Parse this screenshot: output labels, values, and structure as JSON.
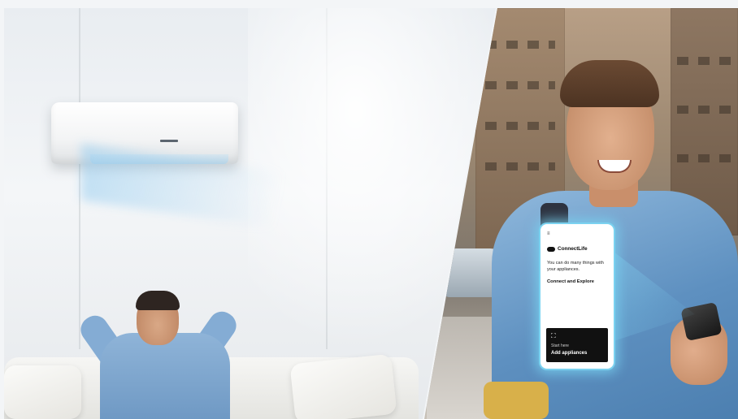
{
  "phone_ui": {
    "menu_glyph": "≡",
    "brand_logo_icon": "connectlife-logo-icon",
    "brand_name": "ConnectLife",
    "tagline": "You can do many things with your appliances.",
    "cta": "Connect and Explore",
    "card_icon": "expand-icon",
    "card_icon_glyph": "⛶",
    "card_subtitle": "Start here",
    "card_title": "Add appliances"
  },
  "colors": {
    "glow": "#7fd3ee",
    "card_bg": "#111111",
    "shirt_blue": "#5e90c0"
  }
}
